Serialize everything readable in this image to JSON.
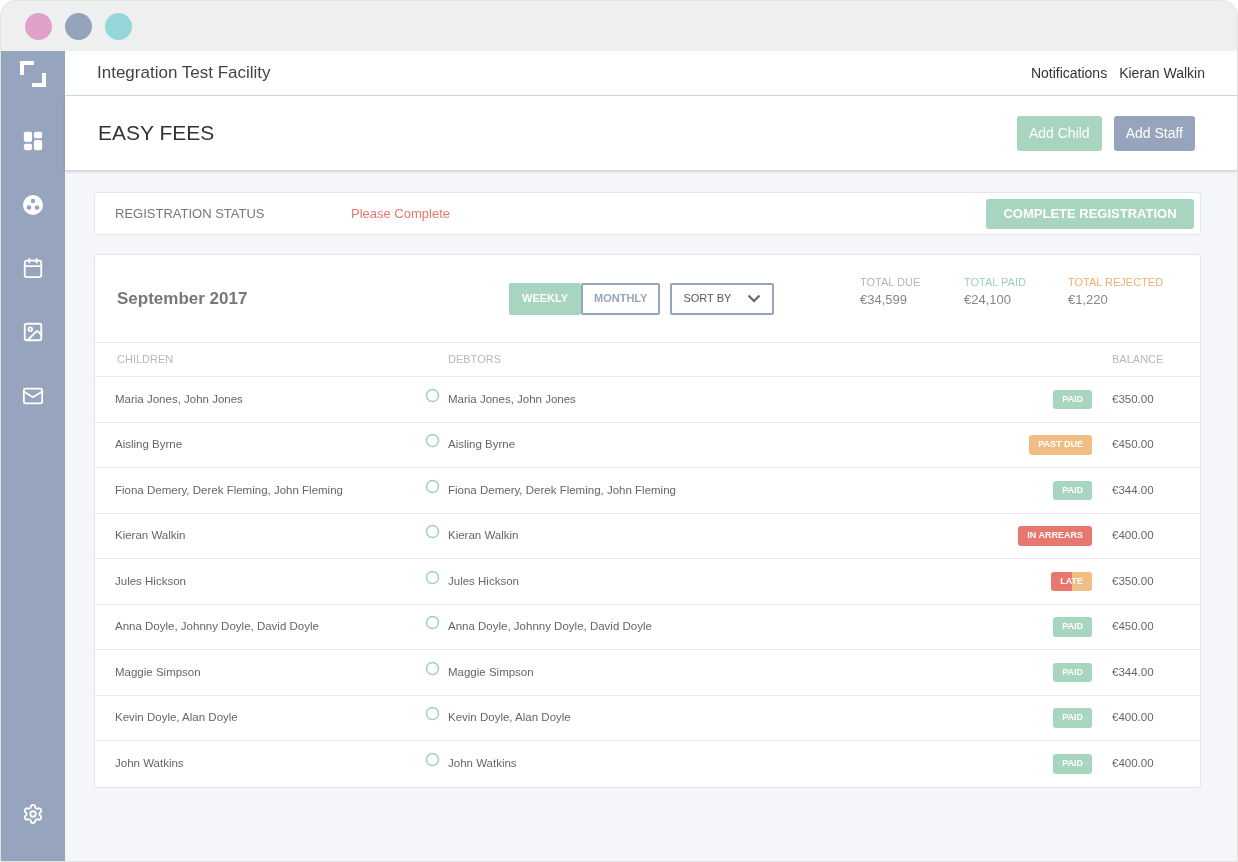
{
  "header": {
    "facility": "Integration Test Facility",
    "links": [
      "Notifications",
      "Kieran Walkin"
    ]
  },
  "page": {
    "title": "EASY FEES",
    "buttons": [
      {
        "label": "Add Child",
        "kind": "green"
      },
      {
        "label": "Add Staff",
        "kind": "slate"
      }
    ]
  },
  "registration": {
    "label": "REGISTRATION STATUS",
    "status": "Please Complete",
    "button": "COMPLETE REGISTRATION"
  },
  "period": {
    "title": "September 2017",
    "toggle": [
      {
        "label": "WEEKLY",
        "selected": true
      },
      {
        "label": "MONTHLY",
        "selected": false
      }
    ],
    "sort": "SORT BY"
  },
  "totals": [
    {
      "label": "TOTAL DUE",
      "value": "€34,599",
      "kind": "due"
    },
    {
      "label": "TOTAL PAID",
      "value": "€24,100",
      "kind": "paid"
    },
    {
      "label": "TOTAL REJECTED",
      "value": "€1,220",
      "kind": "rejected"
    }
  ],
  "table": {
    "columns": [
      "CHILDREN",
      "DEBTORS",
      "BALANCE"
    ],
    "rows": [
      {
        "children": "Maria Jones, John Jones",
        "debtors": "Maria Jones, John Jones",
        "status": "PAID",
        "kind": "paid",
        "balance": "€350.00"
      },
      {
        "children": "Aisling Byrne",
        "debtors": "Aisling Byrne",
        "status": "PAST DUE",
        "kind": "past_due",
        "balance": "€450.00"
      },
      {
        "children": "Fiona Demery, Derek Fleming, John Fleming",
        "debtors": "Fiona Demery, Derek Fleming, John Fleming",
        "status": "PAID",
        "kind": "paid",
        "balance": "€344.00"
      },
      {
        "children": "Kieran Walkin",
        "debtors": "Kieran Walkin",
        "status": "IN ARREARS",
        "kind": "in_arrears",
        "balance": "€400.00"
      },
      {
        "children": "Jules Hickson",
        "debtors": "Jules Hickson",
        "status": "LATE",
        "kind": "late",
        "balance": "€350.00"
      },
      {
        "children": "Anna Doyle, Johnny Doyle, David Doyle",
        "debtors": "Anna Doyle, Johnny Doyle, David Doyle",
        "status": "PAID",
        "kind": "paid",
        "balance": "€450.00"
      },
      {
        "children": "Maggie Simpson",
        "debtors": "Maggie Simpson",
        "status": "PAID",
        "kind": "paid",
        "balance": "€344.00"
      },
      {
        "children": "Kevin Doyle, Alan Doyle",
        "debtors": "Kevin Doyle, Alan Doyle",
        "status": "PAID",
        "kind": "paid",
        "balance": "€400.00"
      },
      {
        "children": "John Watkins",
        "debtors": "John Watkins",
        "status": "PAID",
        "kind": "paid",
        "balance": "€400.00"
      }
    ]
  }
}
